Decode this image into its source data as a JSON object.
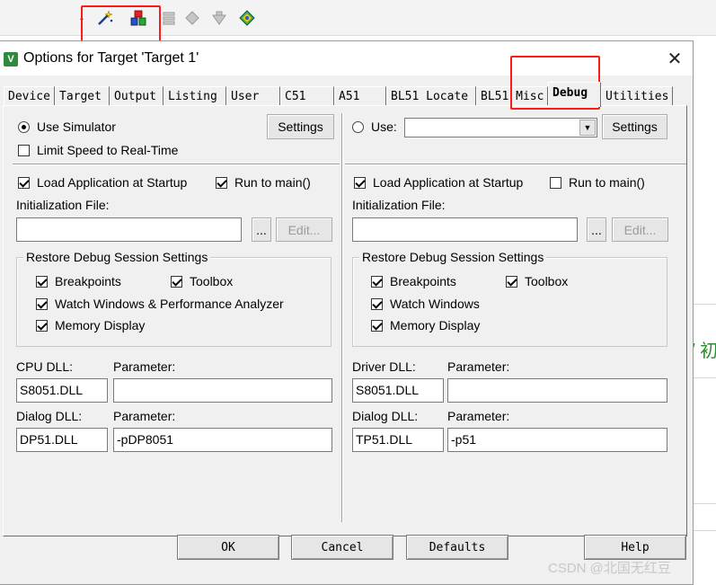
{
  "window": {
    "title": "Options for Target 'Target 1'",
    "app_icon": "uvision-icon"
  },
  "tabs": [
    {
      "label": "Device",
      "active": false
    },
    {
      "label": "Target",
      "active": false
    },
    {
      "label": "Output",
      "active": false
    },
    {
      "label": "Listing",
      "active": false
    },
    {
      "label": "User",
      "active": false
    },
    {
      "label": "C51",
      "active": false
    },
    {
      "label": "A51",
      "active": false
    },
    {
      "label": "BL51 Locate",
      "active": false
    },
    {
      "label": "BL51 Misc",
      "active": false
    },
    {
      "label": "Debug",
      "active": true
    },
    {
      "label": "Utilities",
      "active": false
    }
  ],
  "left": {
    "use_simulator": {
      "label": "Use Simulator",
      "checked": true
    },
    "settings_button": "Settings",
    "limit_speed": {
      "label": "Limit Speed to Real-Time",
      "checked": false
    },
    "load_app": {
      "label": "Load Application at Startup",
      "checked": true
    },
    "run_to_main": {
      "label": "Run to main()",
      "checked": true
    },
    "init_file_label": "Initialization File:",
    "init_file_value": "",
    "browse_button": "...",
    "edit_button": "Edit...",
    "restore_group_title": "Restore Debug Session Settings",
    "breakpoints": {
      "label": "Breakpoints",
      "checked": true
    },
    "toolbox": {
      "label": "Toolbox",
      "checked": true
    },
    "watch_windows": {
      "label": "Watch Windows & Performance Analyzer",
      "checked": true
    },
    "memory_display": {
      "label": "Memory Display",
      "checked": true
    },
    "cpu_dll_label": "CPU DLL:",
    "cpu_dll_value": "S8051.DLL",
    "cpu_param_label": "Parameter:",
    "cpu_param_value": "",
    "dialog_dll_label": "Dialog DLL:",
    "dialog_dll_value": "DP51.DLL",
    "dialog_param_label": "Parameter:",
    "dialog_param_value": "-pDP8051"
  },
  "right": {
    "use": {
      "label": "Use:",
      "checked": false
    },
    "use_combo_value": "",
    "settings_button": "Settings",
    "load_app": {
      "label": "Load Application at Startup",
      "checked": true
    },
    "run_to_main": {
      "label": "Run to main()",
      "checked": false
    },
    "init_file_label": "Initialization File:",
    "init_file_value": "",
    "browse_button": "...",
    "edit_button": "Edit...",
    "restore_group_title": "Restore Debug Session Settings",
    "breakpoints": {
      "label": "Breakpoints",
      "checked": true
    },
    "toolbox": {
      "label": "Toolbox",
      "checked": true
    },
    "watch_windows": {
      "label": "Watch Windows",
      "checked": true
    },
    "memory_display": {
      "label": "Memory Display",
      "checked": true
    },
    "driver_dll_label": "Driver DLL:",
    "driver_dll_value": "S8051.DLL",
    "driver_param_label": "Parameter:",
    "driver_param_value": "",
    "dialog_dll_label": "Dialog DLL:",
    "dialog_dll_value": "TP51.DLL",
    "dialog_param_label": "Parameter:",
    "dialog_param_value": "-p51"
  },
  "footer": {
    "ok": "OK",
    "cancel": "Cancel",
    "defaults": "Defaults",
    "help": "Help"
  },
  "background": {
    "code_fragment": "/ 初",
    "watermark": "CSDN @北国无红豆"
  },
  "colors": {
    "highlight": "#ff1a1a",
    "title_icon": "#2f8a3e"
  }
}
